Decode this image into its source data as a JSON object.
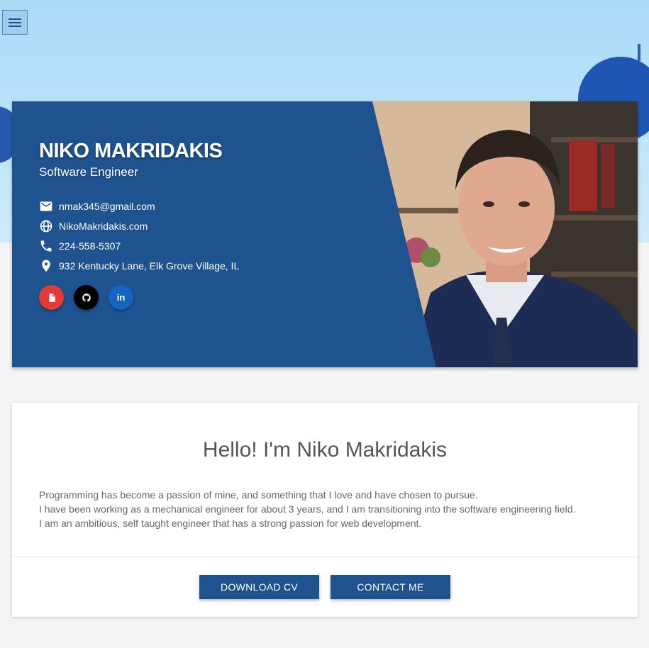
{
  "profile": {
    "name": "NIKO MAKRIDAKIS",
    "role": "Software Engineer",
    "email": "nmak345@gmail.com",
    "website": "NikoMakridakis.com",
    "phone": "224-558-5307",
    "address": "932 Kentucky Lane, Elk Grove Village, IL"
  },
  "socials": [
    {
      "icon": "document-icon",
      "color": "#e53935"
    },
    {
      "icon": "github-icon",
      "color": "#000000"
    },
    {
      "icon": "linkedin-icon",
      "label": "in",
      "color": "#1565c0"
    }
  ],
  "about": {
    "title": "Hello! I'm Niko Makridakis",
    "lines": [
      "Programming has become a passion of mine, and something that I love and have chosen to pursue.",
      "I have been working as a mechanical engineer for about 3 years, and I am transitioning into the software engineering field.",
      "I am an ambitious, self taught engineer that has a strong passion for web development."
    ]
  },
  "actions": {
    "download": "DOWNLOAD CV",
    "contact": "CONTACT ME"
  },
  "colors": {
    "primary": "#1f5390",
    "sky": "#b7e1f8",
    "page_bg": "#f4f4f4"
  }
}
